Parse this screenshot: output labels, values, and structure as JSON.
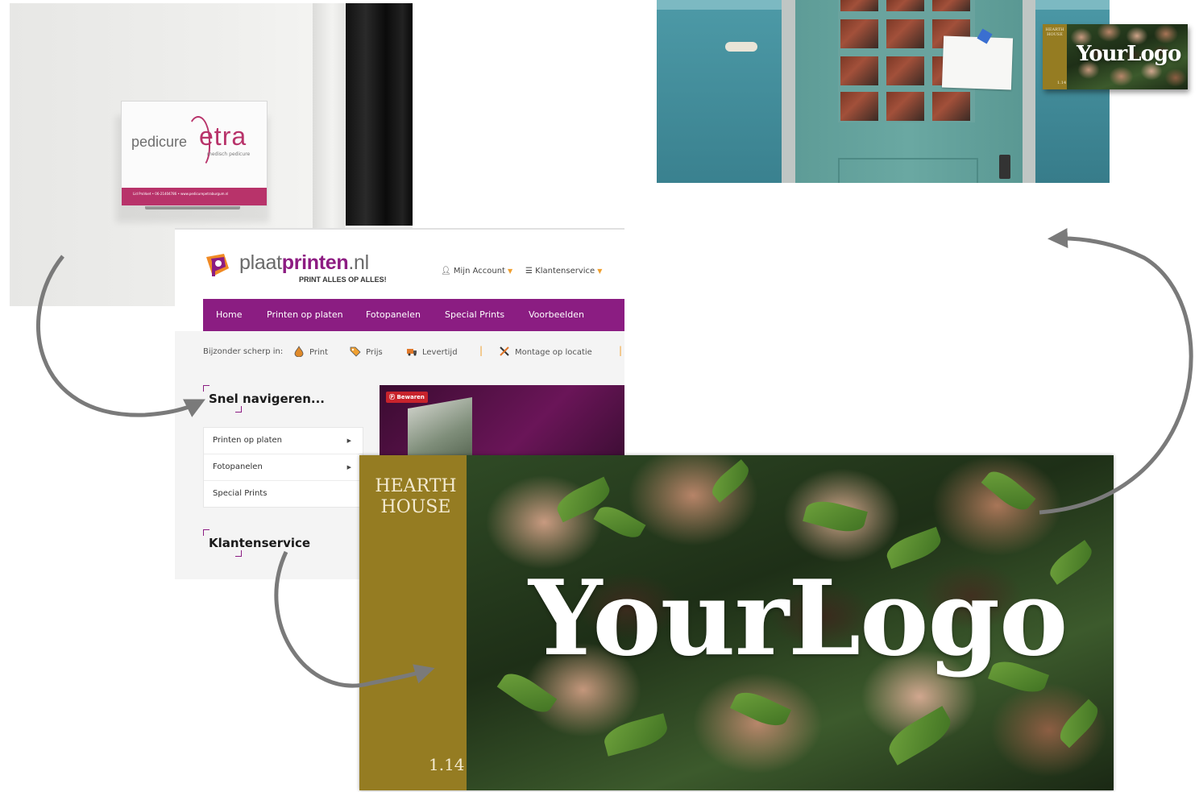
{
  "pedicure_sign": {
    "word1": "pedicure",
    "word2": "etra",
    "subtitle": "medisch pedicure",
    "footer": "Lid ProVoet • 06-21404786 • www.pedicurepetraburgum.nl"
  },
  "site": {
    "logo_brand": "plaat",
    "logo_brand_bold": "printen",
    "logo_tld": ".nl",
    "logo_tagline": "PRINT ALLES OP ALLES!",
    "account": "Mijn Account",
    "service": "Klantenservice",
    "nav": [
      "Home",
      "Printen op platen",
      "Fotopanelen",
      "Special Prints",
      "Voorbeelden"
    ],
    "usp_intro": "Bijzonder scherp in:",
    "usps": [
      "Print",
      "Prijs",
      "Levertijd",
      "Montage op locatie"
    ],
    "quick_nav_title": "Snel navigeren...",
    "quick_nav": [
      {
        "label": "Printen op platen",
        "has_arrow": true
      },
      {
        "label": "Fotopanelen",
        "has_arrow": true
      },
      {
        "label": "Special Prints",
        "has_arrow": false
      }
    ],
    "service_title": "Klantenservice",
    "pin_label": "Bewaren"
  },
  "hearth_sign": {
    "house_line1": "HEARTH",
    "house_line2": "HOUSE",
    "number": "1.14",
    "logo": "YourLogo"
  },
  "colors": {
    "brand_purple": "#8b1d82",
    "accent_orange": "#f0a030",
    "sign_gold": "#957c22",
    "pedicure_pink": "#b8336a",
    "arrow_grey": "#7a7a7a"
  }
}
